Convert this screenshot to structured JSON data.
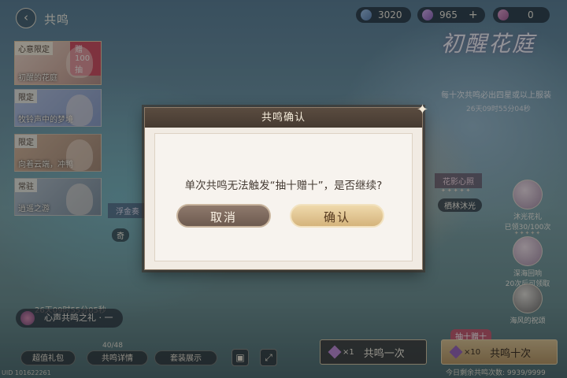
{
  "header": {
    "back_label": "‹",
    "title": "共鸣"
  },
  "resources": [
    {
      "icon": "diamond-icon",
      "value": "3020"
    },
    {
      "icon": "crystal-icon",
      "value": "965"
    },
    {
      "icon": "feather-icon",
      "value": "0"
    }
  ],
  "plus_label": "+",
  "banners": [
    {
      "tag": "心意限定",
      "badge": "赠100抽",
      "name": "初醒的花庭"
    },
    {
      "tag": "限定",
      "name": "牧铃声中的梦境"
    },
    {
      "tag": "限定",
      "name": "向着云端，冲鸭"
    },
    {
      "tag": "常驻",
      "name": "逍遥之游"
    }
  ],
  "logo": "初醒花庭",
  "logo_sub": "每十次共鸣必出四星或以上服装",
  "timer_right": "26天09时55分04秒",
  "flower_tag": "花影心照",
  "flower_stars": "✦✦✦✦✦",
  "flower_item": "栖林沐光",
  "float_tag": "浮金奏",
  "float_item": "奇",
  "right_items": [
    {
      "stars": "✦✦✦✦✦",
      "name": "沐光花礼",
      "detail": "已领30/100次"
    },
    {
      "stars": "✦✦✦✦✦",
      "name": "深海回响",
      "detail": "20次后可领取"
    },
    {
      "stars": "",
      "name": "海风的祝颂",
      "detail": ""
    }
  ],
  "bottom": {
    "timer": "26天09时55分05秒",
    "gift": "心声共鸣之礼 · 一",
    "counter": "40/48",
    "buttons": [
      "超值礼包",
      "共鸣详情",
      "套装展示"
    ],
    "uid": "UID 101622261",
    "pull_one": {
      "mult": "×1",
      "label": "共鸣一次"
    },
    "pull_ten": {
      "tag": "抽十赠十",
      "mult": "×10",
      "label": "共鸣十次"
    },
    "remaining": "今日剩余共鸣次数: 9939/9999"
  },
  "dialog": {
    "title": "共鸣确认",
    "message": "单次共鸣无法触发“抽十赠十”，是否继续?",
    "cancel": "取消",
    "confirm": "确认"
  }
}
